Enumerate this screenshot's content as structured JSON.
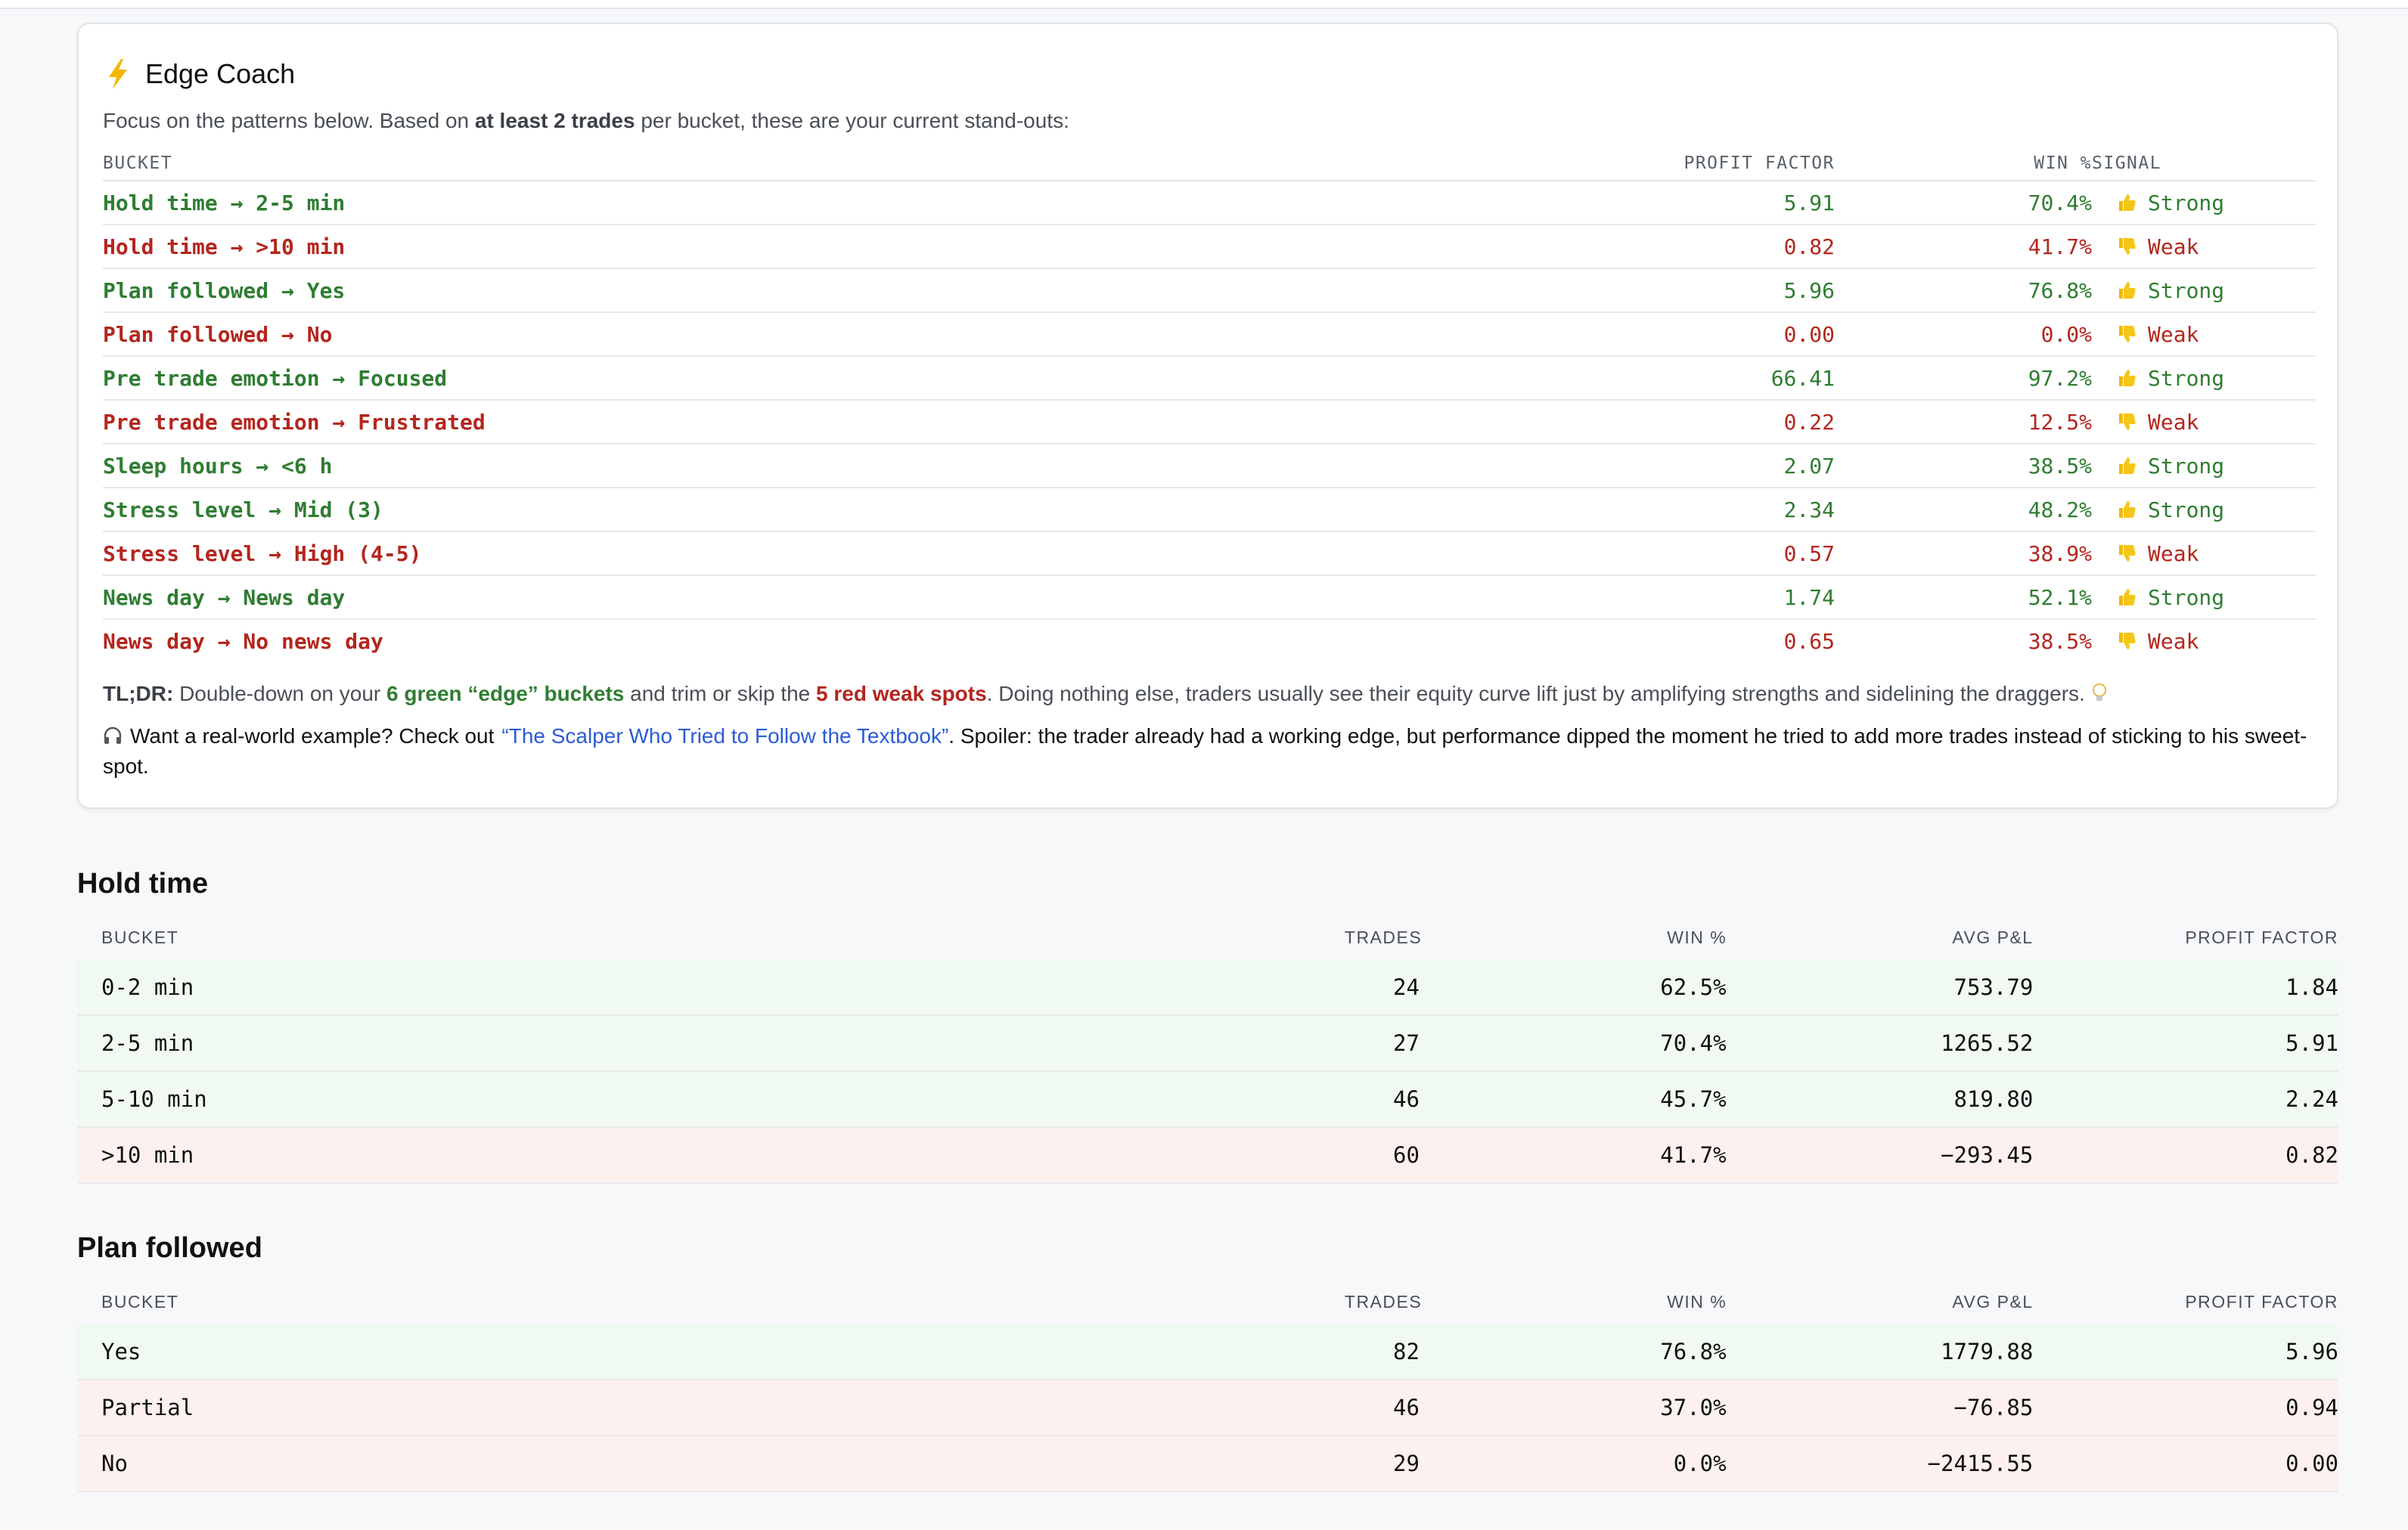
{
  "coach": {
    "title": "Edge Coach",
    "subtitle_pre": "Focus on the patterns below. Based on ",
    "subtitle_bold": "at least 2 trades",
    "subtitle_post": " per bucket, these are your current stand-outs:",
    "headers": {
      "bucket": "BUCKET",
      "profit_factor": "PROFIT FACTOR",
      "win": "WIN %",
      "signal": "SIGNAL"
    },
    "rows": [
      {
        "bucket": "Hold time → 2-5 min",
        "pf": "5.91",
        "win": "70.4%",
        "signal": "Strong",
        "kind": "good"
      },
      {
        "bucket": "Hold time → >10 min",
        "pf": "0.82",
        "win": "41.7%",
        "signal": "Weak",
        "kind": "bad"
      },
      {
        "bucket": "Plan followed → Yes",
        "pf": "5.96",
        "win": "76.8%",
        "signal": "Strong",
        "kind": "good"
      },
      {
        "bucket": "Plan followed → No",
        "pf": "0.00",
        "win": "0.0%",
        "signal": "Weak",
        "kind": "bad"
      },
      {
        "bucket": "Pre trade emotion → Focused",
        "pf": "66.41",
        "win": "97.2%",
        "signal": "Strong",
        "kind": "good"
      },
      {
        "bucket": "Pre trade emotion → Frustrated",
        "pf": "0.22",
        "win": "12.5%",
        "signal": "Weak",
        "kind": "bad"
      },
      {
        "bucket": "Sleep hours → <6 h",
        "pf": "2.07",
        "win": "38.5%",
        "signal": "Strong",
        "kind": "good"
      },
      {
        "bucket": "Stress level → Mid (3)",
        "pf": "2.34",
        "win": "48.2%",
        "signal": "Strong",
        "kind": "good"
      },
      {
        "bucket": "Stress level → High (4-5)",
        "pf": "0.57",
        "win": "38.9%",
        "signal": "Weak",
        "kind": "bad"
      },
      {
        "bucket": "News day → News day",
        "pf": "1.74",
        "win": "52.1%",
        "signal": "Strong",
        "kind": "good"
      },
      {
        "bucket": "News day → No news day",
        "pf": "0.65",
        "win": "38.5%",
        "signal": "Weak",
        "kind": "bad"
      }
    ],
    "tldr": {
      "label": "TL;DR:",
      "t1": " Double-down on your ",
      "green": "6 green “edge” buckets",
      "t2": " and trim or skip the ",
      "red": "5 red weak spots",
      "t3": ". Doing nothing else, traders usually see their equity curve lift just by amplifying strengths and sidelining the draggers."
    },
    "example": {
      "pre": "Want a real-world example? Check out",
      "link": "“The Scalper Who Tried to Follow the Textbook”",
      "post": ". Spoiler: the trader already had a working edge, but performance dipped the moment he tried to add more trades instead of sticking to his sweet-spot."
    }
  },
  "sections": [
    {
      "title": "Hold time",
      "headers": {
        "bucket": "BUCKET",
        "trades": "TRADES",
        "win": "WIN %",
        "avg": "AVG P&L",
        "pf": "PROFIT FACTOR"
      },
      "rows": [
        {
          "bucket": "0-2 min",
          "trades": "24",
          "win": "62.5%",
          "avg": "753.79",
          "pf": "1.84",
          "kind": "good"
        },
        {
          "bucket": "2-5 min",
          "trades": "27",
          "win": "70.4%",
          "avg": "1265.52",
          "pf": "5.91",
          "kind": "good"
        },
        {
          "bucket": "5-10 min",
          "trades": "46",
          "win": "45.7%",
          "avg": "819.80",
          "pf": "2.24",
          "kind": "good"
        },
        {
          "bucket": ">10 min",
          "trades": "60",
          "win": "41.7%",
          "avg": "−293.45",
          "pf": "0.82",
          "kind": "bad"
        }
      ]
    },
    {
      "title": "Plan followed",
      "headers": {
        "bucket": "BUCKET",
        "trades": "TRADES",
        "win": "WIN %",
        "avg": "AVG P&L",
        "pf": "PROFIT FACTOR"
      },
      "rows": [
        {
          "bucket": "Yes",
          "trades": "82",
          "win": "76.8%",
          "avg": "1779.88",
          "pf": "5.96",
          "kind": "good"
        },
        {
          "bucket": "Partial",
          "trades": "46",
          "win": "37.0%",
          "avg": "−76.85",
          "pf": "0.94",
          "kind": "bad"
        },
        {
          "bucket": "No",
          "trades": "29",
          "win": "0.0%",
          "avg": "−2415.55",
          "pf": "0.00",
          "kind": "bad"
        }
      ]
    }
  ]
}
